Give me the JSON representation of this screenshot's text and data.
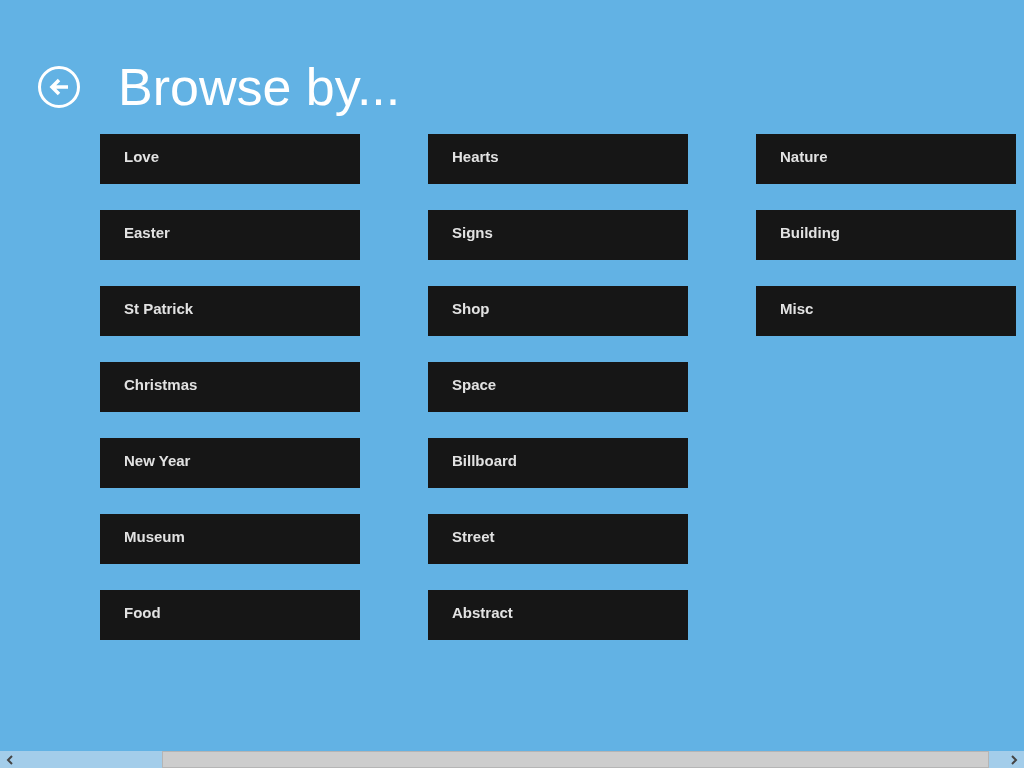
{
  "header": {
    "title": "Browse by..."
  },
  "categories": [
    {
      "label": "Love"
    },
    {
      "label": "Easter"
    },
    {
      "label": "St Patrick"
    },
    {
      "label": "Christmas"
    },
    {
      "label": "New Year"
    },
    {
      "label": "Museum"
    },
    {
      "label": "Food"
    },
    {
      "label": "Hearts"
    },
    {
      "label": "Signs"
    },
    {
      "label": "Shop"
    },
    {
      "label": "Space"
    },
    {
      "label": "Billboard"
    },
    {
      "label": "Street"
    },
    {
      "label": "Abstract"
    },
    {
      "label": "Nature"
    },
    {
      "label": "Building"
    },
    {
      "label": "Misc"
    }
  ]
}
